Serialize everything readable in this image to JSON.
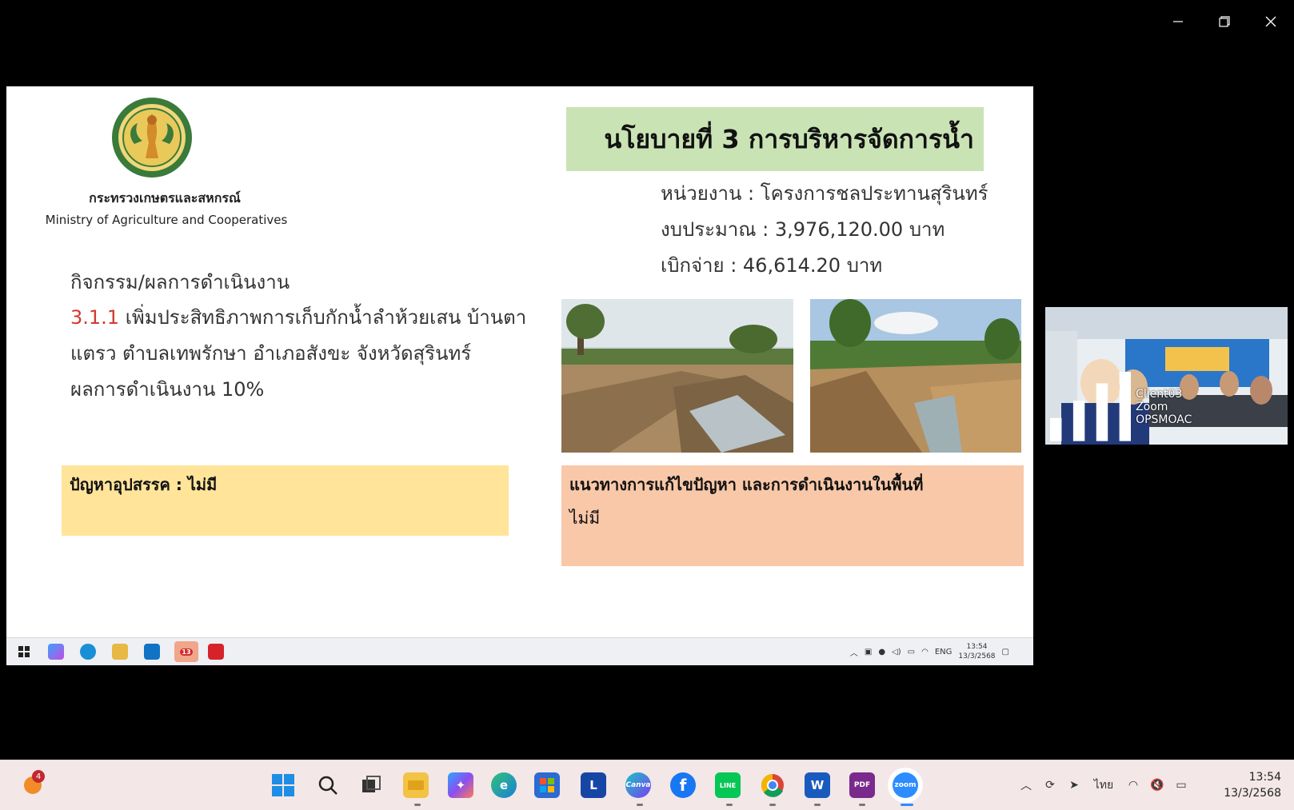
{
  "slide": {
    "org_name_th": "กระทรวงเกษตรและสหกรณ์",
    "org_name_en": "Ministry of Agriculture and Cooperatives",
    "policy_title": "นโยบายที่ 3 การบริหารจัดการน้ำ",
    "agency": "หน่วยงาน : โครงการชลประทานสุรินทร์",
    "budget": "งบประมาณ : 3,976,120.00 บาท",
    "disbursed": "เบิกจ่าย : 46,614.20 บาท",
    "activity_title": "กิจกรรม/ผลการดำเนินงาน",
    "activity_number": "3.1.1",
    "activity_text": "เพิ่มประสิทธิภาพการเก็บกักน้ำลำห้วยเสน บ้านตาแตรว ตำบลเทพรักษา อำเภอสังขะ จังหวัดสุรินทร์",
    "progress": "ผลการดำเนินงาน 10%",
    "obstacles": "ปัญหาอุปสรรค : ไม่มี",
    "solution_title": "แนวทางการแก้ไขปัญหา และการดำเนินงานในพื้นที่",
    "solution_value": "ไม่มี"
  },
  "inner_taskbar": {
    "language": "ENG",
    "time": "13:54",
    "date": "13/3/2568",
    "badge": "13"
  },
  "participant": {
    "name": "Client03 Zoom OPSMOAC"
  },
  "taskbar": {
    "weather_badge": "4",
    "language": "ไทย",
    "time": "13:54",
    "date": "13/3/2568",
    "icons": [
      "start-icon",
      "search-icon",
      "task-view-icon",
      "file-explorer-icon",
      "copilot-icon",
      "edge-icon",
      "store-icon",
      "l-app-icon",
      "canva-icon",
      "facebook-icon",
      "line-icon",
      "chrome-icon",
      "word-icon",
      "pdf-icon",
      "zoom-icon"
    ],
    "labels": {
      "l_app": "L",
      "canva": "Canva",
      "line": "LINE",
      "word": "W",
      "pdf": "PDF",
      "zoom": "zoom"
    }
  }
}
